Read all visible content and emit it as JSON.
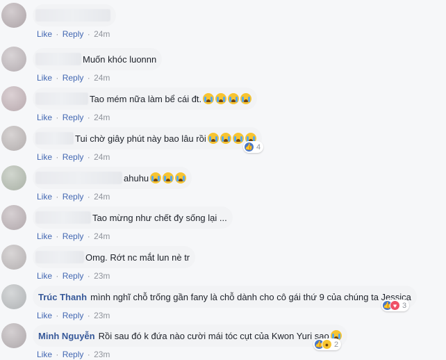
{
  "ui": {
    "like_label": "Like",
    "reply_label": "Reply",
    "separator": "·"
  },
  "comments": [
    {
      "author": "",
      "text": "",
      "time": "24m"
    },
    {
      "author": "",
      "text": "Muốn khóc luonnn",
      "time": "24m"
    },
    {
      "author": "",
      "text": "Tao mém nữa làm bể cái đt.",
      "time": "24m",
      "emoji_count": 4
    },
    {
      "author": "",
      "text": "Tui chờ giây phút này bao lâu rồi",
      "time": "24m",
      "emoji_count": 4,
      "reaction_count": "4"
    },
    {
      "author": "",
      "text": "ahuhu",
      "time": "24m",
      "emoji_count": 3
    },
    {
      "author": "",
      "text": "Tao mừng như chết đy sống lại ...",
      "time": "24m"
    },
    {
      "author": "",
      "text": "Omg. Rớt nc mắt lun nè tr",
      "time": "23m"
    },
    {
      "author": "Trúc Thanh",
      "text": "mình nghĩ chỗ trống gần fany là chỗ dành cho cô gái thứ 9 của chúng ta Jessica",
      "time": "23m",
      "reaction_count": "3"
    },
    {
      "author": "Minh Nguyễn",
      "text": "Rồi sau đó k đứa nào cười mái tóc cụt của Kwon Yuri sao",
      "time": "23m",
      "emoji_count": 1,
      "reaction_count": "2"
    }
  ],
  "icons": {
    "crying_emoji": "loudly-crying-face-icon",
    "reactions": [
      "like-reaction-icon",
      "love-reaction-icon",
      "haha-reaction-icon"
    ]
  },
  "colors": {
    "author": "#365899",
    "link": "#4267b2",
    "meta": "#90949c",
    "bubble": "#f2f3f5",
    "background": "#f6f7f9"
  }
}
